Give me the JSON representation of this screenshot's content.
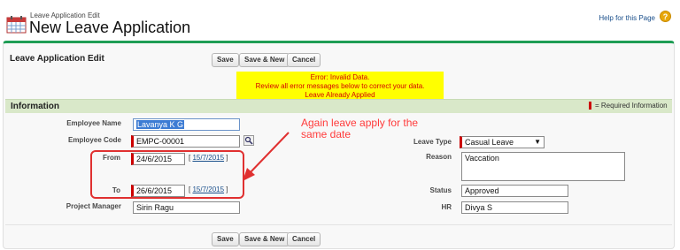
{
  "header": {
    "subtitle": "Leave Application Edit",
    "title": "New Leave Application",
    "help_link": "Help for this Page",
    "help_icon": "help-icon"
  },
  "panel": {
    "title": "Leave Application Edit",
    "buttons": {
      "save": "Save",
      "save_new": "Save & New",
      "cancel": "Cancel"
    }
  },
  "error": {
    "line1": "Error: Invalid Data.",
    "line2": "Review all error messages below to correct your data.",
    "line3": "Leave Already Applied"
  },
  "section": {
    "title": "Information",
    "required_legend": "= Required Information"
  },
  "form": {
    "employee_name": {
      "label": "Employee Name",
      "value": "Lavanya K G"
    },
    "employee_code": {
      "label": "Employee Code",
      "value": "EMPC-00001"
    },
    "from": {
      "label": "From",
      "value": "24/6/2015",
      "today": "15/7/2015"
    },
    "to": {
      "label": "To",
      "value": "26/6/2015",
      "today": "15/7/2015"
    },
    "project_manager": {
      "label": "Project Manager",
      "value": "Sirin Ragu"
    },
    "leave_type": {
      "label": "Leave Type",
      "value": "Casual Leave"
    },
    "reason": {
      "label": "Reason",
      "value": "Vaccation"
    },
    "status": {
      "label": "Status",
      "value": "Approved"
    },
    "hr": {
      "label": "HR",
      "value": "Divya S"
    }
  },
  "annotation": {
    "text": "Again leave apply for the same date"
  },
  "colors": {
    "accent_green": "#1f9d55",
    "error_red": "#d40000",
    "error_bg": "#ffff00",
    "annotation_red": "#e03030"
  }
}
